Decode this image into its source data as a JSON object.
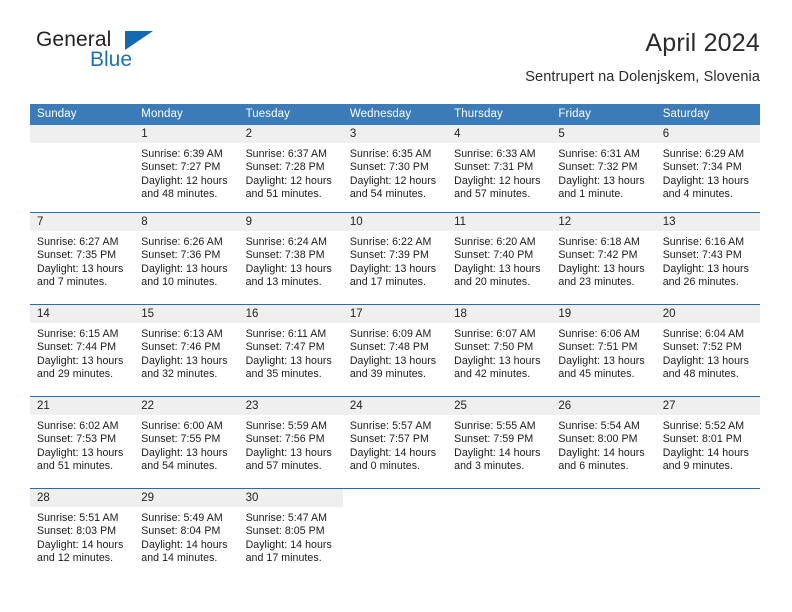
{
  "branding": {
    "name_part1": "General",
    "name_part2": "Blue",
    "triangle_color": "#1268b3",
    "blue_color": "#1d70b8"
  },
  "header": {
    "title": "April 2024",
    "subtitle": "Sentrupert na Dolenjskem, Slovenia"
  },
  "theme": {
    "header_bar_color": "#3b7cb8",
    "week_divider_color": "#2f6aa8",
    "daynum_band_color": "#efefef"
  },
  "weekdays": [
    "Sunday",
    "Monday",
    "Tuesday",
    "Wednesday",
    "Thursday",
    "Friday",
    "Saturday"
  ],
  "weeks": [
    [
      {
        "day": "",
        "lines": []
      },
      {
        "day": "1",
        "lines": [
          "Sunrise: 6:39 AM",
          "Sunset: 7:27 PM",
          "Daylight: 12 hours",
          "and 48 minutes."
        ]
      },
      {
        "day": "2",
        "lines": [
          "Sunrise: 6:37 AM",
          "Sunset: 7:28 PM",
          "Daylight: 12 hours",
          "and 51 minutes."
        ]
      },
      {
        "day": "3",
        "lines": [
          "Sunrise: 6:35 AM",
          "Sunset: 7:30 PM",
          "Daylight: 12 hours",
          "and 54 minutes."
        ]
      },
      {
        "day": "4",
        "lines": [
          "Sunrise: 6:33 AM",
          "Sunset: 7:31 PM",
          "Daylight: 12 hours",
          "and 57 minutes."
        ]
      },
      {
        "day": "5",
        "lines": [
          "Sunrise: 6:31 AM",
          "Sunset: 7:32 PM",
          "Daylight: 13 hours",
          "and 1 minute."
        ]
      },
      {
        "day": "6",
        "lines": [
          "Sunrise: 6:29 AM",
          "Sunset: 7:34 PM",
          "Daylight: 13 hours",
          "and 4 minutes."
        ]
      }
    ],
    [
      {
        "day": "7",
        "lines": [
          "Sunrise: 6:27 AM",
          "Sunset: 7:35 PM",
          "Daylight: 13 hours",
          "and 7 minutes."
        ]
      },
      {
        "day": "8",
        "lines": [
          "Sunrise: 6:26 AM",
          "Sunset: 7:36 PM",
          "Daylight: 13 hours",
          "and 10 minutes."
        ]
      },
      {
        "day": "9",
        "lines": [
          "Sunrise: 6:24 AM",
          "Sunset: 7:38 PM",
          "Daylight: 13 hours",
          "and 13 minutes."
        ]
      },
      {
        "day": "10",
        "lines": [
          "Sunrise: 6:22 AM",
          "Sunset: 7:39 PM",
          "Daylight: 13 hours",
          "and 17 minutes."
        ]
      },
      {
        "day": "11",
        "lines": [
          "Sunrise: 6:20 AM",
          "Sunset: 7:40 PM",
          "Daylight: 13 hours",
          "and 20 minutes."
        ]
      },
      {
        "day": "12",
        "lines": [
          "Sunrise: 6:18 AM",
          "Sunset: 7:42 PM",
          "Daylight: 13 hours",
          "and 23 minutes."
        ]
      },
      {
        "day": "13",
        "lines": [
          "Sunrise: 6:16 AM",
          "Sunset: 7:43 PM",
          "Daylight: 13 hours",
          "and 26 minutes."
        ]
      }
    ],
    [
      {
        "day": "14",
        "lines": [
          "Sunrise: 6:15 AM",
          "Sunset: 7:44 PM",
          "Daylight: 13 hours",
          "and 29 minutes."
        ]
      },
      {
        "day": "15",
        "lines": [
          "Sunrise: 6:13 AM",
          "Sunset: 7:46 PM",
          "Daylight: 13 hours",
          "and 32 minutes."
        ]
      },
      {
        "day": "16",
        "lines": [
          "Sunrise: 6:11 AM",
          "Sunset: 7:47 PM",
          "Daylight: 13 hours",
          "and 35 minutes."
        ]
      },
      {
        "day": "17",
        "lines": [
          "Sunrise: 6:09 AM",
          "Sunset: 7:48 PM",
          "Daylight: 13 hours",
          "and 39 minutes."
        ]
      },
      {
        "day": "18",
        "lines": [
          "Sunrise: 6:07 AM",
          "Sunset: 7:50 PM",
          "Daylight: 13 hours",
          "and 42 minutes."
        ]
      },
      {
        "day": "19",
        "lines": [
          "Sunrise: 6:06 AM",
          "Sunset: 7:51 PM",
          "Daylight: 13 hours",
          "and 45 minutes."
        ]
      },
      {
        "day": "20",
        "lines": [
          "Sunrise: 6:04 AM",
          "Sunset: 7:52 PM",
          "Daylight: 13 hours",
          "and 48 minutes."
        ]
      }
    ],
    [
      {
        "day": "21",
        "lines": [
          "Sunrise: 6:02 AM",
          "Sunset: 7:53 PM",
          "Daylight: 13 hours",
          "and 51 minutes."
        ]
      },
      {
        "day": "22",
        "lines": [
          "Sunrise: 6:00 AM",
          "Sunset: 7:55 PM",
          "Daylight: 13 hours",
          "and 54 minutes."
        ]
      },
      {
        "day": "23",
        "lines": [
          "Sunrise: 5:59 AM",
          "Sunset: 7:56 PM",
          "Daylight: 13 hours",
          "and 57 minutes."
        ]
      },
      {
        "day": "24",
        "lines": [
          "Sunrise: 5:57 AM",
          "Sunset: 7:57 PM",
          "Daylight: 14 hours",
          "and 0 minutes."
        ]
      },
      {
        "day": "25",
        "lines": [
          "Sunrise: 5:55 AM",
          "Sunset: 7:59 PM",
          "Daylight: 14 hours",
          "and 3 minutes."
        ]
      },
      {
        "day": "26",
        "lines": [
          "Sunrise: 5:54 AM",
          "Sunset: 8:00 PM",
          "Daylight: 14 hours",
          "and 6 minutes."
        ]
      },
      {
        "day": "27",
        "lines": [
          "Sunrise: 5:52 AM",
          "Sunset: 8:01 PM",
          "Daylight: 14 hours",
          "and 9 minutes."
        ]
      }
    ],
    [
      {
        "day": "28",
        "lines": [
          "Sunrise: 5:51 AM",
          "Sunset: 8:03 PM",
          "Daylight: 14 hours",
          "and 12 minutes."
        ]
      },
      {
        "day": "29",
        "lines": [
          "Sunrise: 5:49 AM",
          "Sunset: 8:04 PM",
          "Daylight: 14 hours",
          "and 14 minutes."
        ]
      },
      {
        "day": "30",
        "lines": [
          "Sunrise: 5:47 AM",
          "Sunset: 8:05 PM",
          "Daylight: 14 hours",
          "and 17 minutes."
        ]
      },
      {
        "day": "",
        "lines": []
      },
      {
        "day": "",
        "lines": []
      },
      {
        "day": "",
        "lines": []
      },
      {
        "day": "",
        "lines": []
      }
    ]
  ]
}
